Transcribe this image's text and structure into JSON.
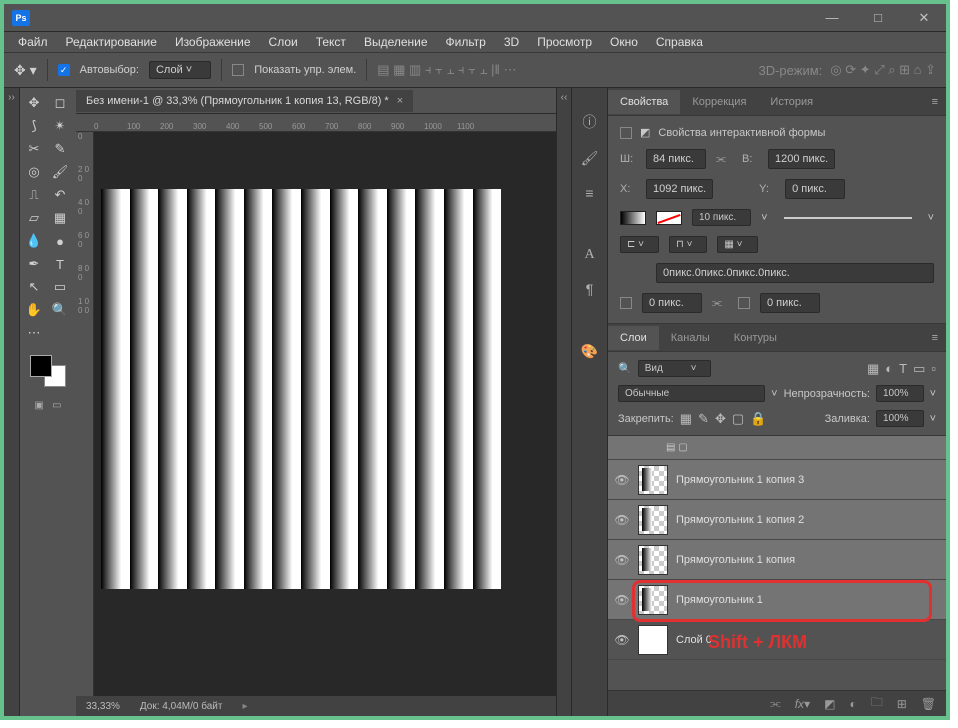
{
  "menu": {
    "file": "Файл",
    "edit": "Редактирование",
    "image": "Изображение",
    "layers": "Слои",
    "type": "Текст",
    "select": "Выделение",
    "filter": "Фильтр",
    "threeD": "3D",
    "view": "Просмотр",
    "window": "Окно",
    "help": "Справка"
  },
  "opt": {
    "auto": "Автовыбор:",
    "layer": "Слой",
    "show": "Показать упр. элем.",
    "mode": "3D-режим:"
  },
  "doc": {
    "tab": "Без имени-1 @ 33,3% (Прямоугольник 1 копия 13, RGB/8) *",
    "zoom": "33,33%",
    "dock": "Док: 4,04M/0 байт"
  },
  "ruler": {
    "h": [
      "0",
      "100",
      "200",
      "300",
      "400",
      "500",
      "600",
      "700",
      "800",
      "900",
      "1000",
      "1100"
    ],
    "v": [
      "0",
      "2 0 0",
      "4 0 0",
      "6 0 0",
      "8 0 0",
      "1 0 0 0"
    ]
  },
  "panel": {
    "props": "Свойства",
    "corr": "Коррекция",
    "hist": "История",
    "title": "Свойства интерактивной формы",
    "w": "Ш:",
    "wVal": "84 пикс.",
    "h": "В:",
    "hVal": "1200 пикс.",
    "x": "X:",
    "xVal": "1092 пикс.",
    "y": "Y:",
    "yVal": "0 пикс.",
    "strokeW": "10 пикс.",
    "corners": "0пикс.0пикс.0пикс.0пикс.",
    "c1": "0 пикс.",
    "c2": "0 пикс."
  },
  "layers": {
    "tab1": "Слои",
    "tab2": "Каналы",
    "tab3": "Контуры",
    "kind": "Вид",
    "blend": "Обычные",
    "opacityL": "Непрозрачность:",
    "opacityV": "100%",
    "lockL": "Закрепить:",
    "fillL": "Заливка:",
    "fillV": "100%",
    "items": [
      {
        "name": "Прямоугольник 1 копия 3"
      },
      {
        "name": "Прямоугольник 1 копия 2"
      },
      {
        "name": "Прямоугольник 1 копия"
      },
      {
        "name": "Прямоугольник 1"
      },
      {
        "name": "Слой 0"
      }
    ]
  },
  "anno": "Shift + ЛКМ"
}
